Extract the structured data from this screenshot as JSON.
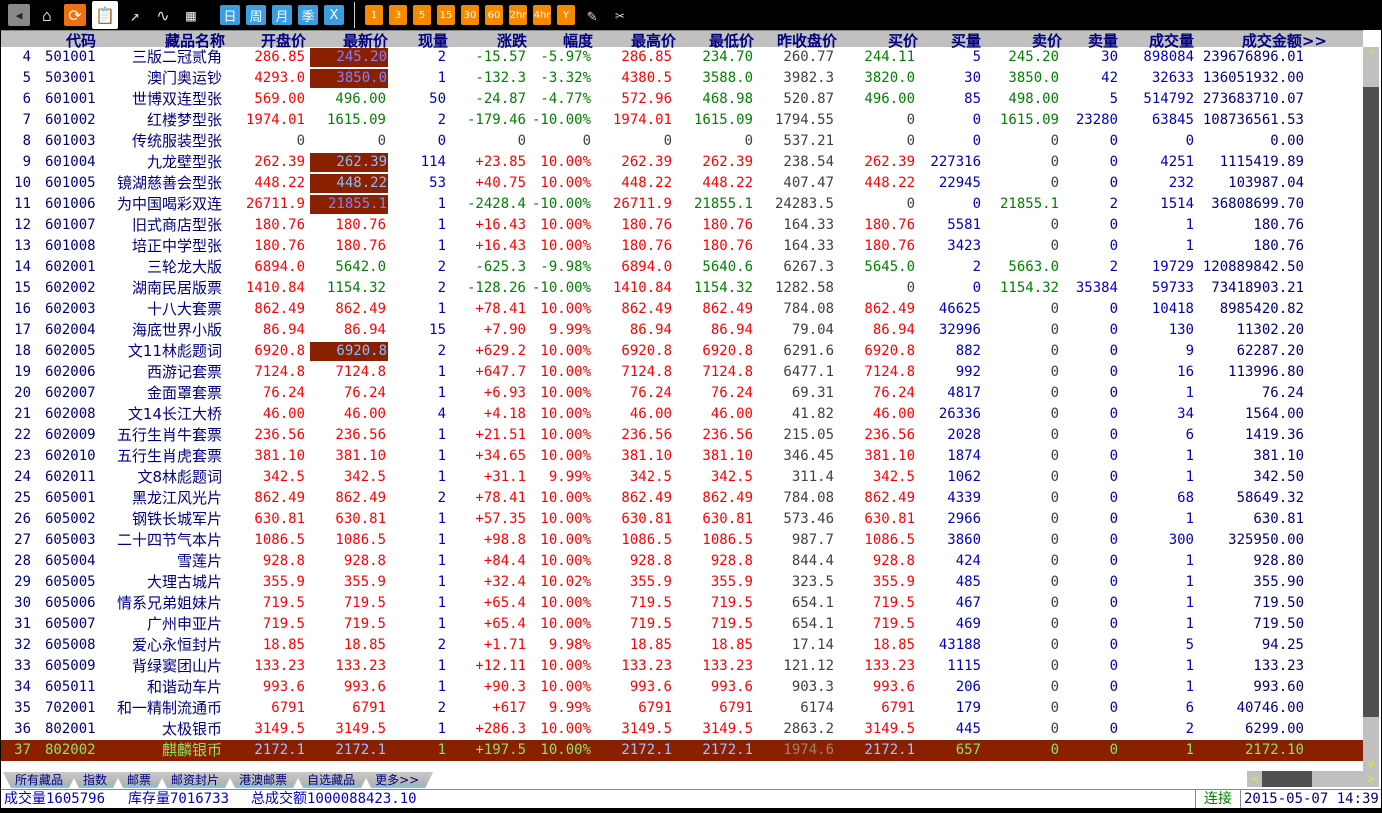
{
  "toolbar": {
    "icons": [
      "back-icon",
      "home-icon",
      "refresh-icon",
      "clipboard-icon",
      "trend-chart-icon",
      "line-chart-icon",
      "table-icon"
    ],
    "period_buttons": [
      "日",
      "周",
      "月",
      "季",
      "X"
    ],
    "minute_buttons": [
      "1",
      "3",
      "5",
      "15",
      "30",
      "60",
      "2hr",
      "4hr",
      "Y"
    ],
    "tools": [
      "pencil-icon",
      "tools-icon"
    ]
  },
  "table": {
    "headers": [
      "代码",
      "藏品名称",
      "开盘价",
      "最新价",
      "现量",
      "涨跌",
      "幅度",
      "最高价",
      "最低价",
      "昨收盘价",
      "买价",
      "买量",
      "卖价",
      "卖量",
      "成交量",
      "成交金额>>"
    ],
    "rows": [
      [
        "4",
        "501001",
        "三版二冠贰角",
        "286.85",
        "245.20",
        "2",
        "-15.57",
        "-5.97%",
        "286.85",
        "234.70",
        "260.77",
        "244.11",
        "5",
        "245.20",
        "30",
        "898084",
        "239676896.01"
      ],
      [
        "5",
        "503001",
        "澳门奥运钞",
        "4293.0",
        "3850.0",
        "1",
        "-132.3",
        "-3.32%",
        "4380.5",
        "3588.0",
        "3982.3",
        "3820.0",
        "30",
        "3850.0",
        "42",
        "32633",
        "136051932.00"
      ],
      [
        "6",
        "601001",
        "世博双连型张",
        "569.00",
        "496.00",
        "50",
        "-24.87",
        "-4.77%",
        "572.96",
        "468.98",
        "520.87",
        "496.00",
        "85",
        "498.00",
        "5",
        "514792",
        "273683710.07"
      ],
      [
        "7",
        "601002",
        "红楼梦型张",
        "1974.01",
        "1615.09",
        "2",
        "-179.46",
        "-10.00%",
        "1974.01",
        "1615.09",
        "1794.55",
        "0",
        "0",
        "1615.09",
        "23280",
        "63845",
        "108736561.53"
      ],
      [
        "8",
        "601003",
        "传统服装型张",
        "0",
        "0",
        "0",
        "0",
        "0",
        "0",
        "0",
        "537.21",
        "0",
        "0",
        "0",
        "0",
        "0",
        "0.00"
      ],
      [
        "9",
        "601004",
        "九龙壁型张",
        "262.39",
        "262.39",
        "114",
        "+23.85",
        "10.00%",
        "262.39",
        "262.39",
        "238.54",
        "262.39",
        "227316",
        "0",
        "0",
        "4251",
        "1115419.89"
      ],
      [
        "10",
        "601005",
        "镜湖慈善会型张",
        "448.22",
        "448.22",
        "53",
        "+40.75",
        "10.00%",
        "448.22",
        "448.22",
        "407.47",
        "448.22",
        "22945",
        "0",
        "0",
        "232",
        "103987.04"
      ],
      [
        "11",
        "601006",
        "为中国喝彩双连",
        "26711.9",
        "21855.1",
        "1",
        "-2428.4",
        "-10.00%",
        "26711.9",
        "21855.1",
        "24283.5",
        "0",
        "0",
        "21855.1",
        "2",
        "1514",
        "36808699.70"
      ],
      [
        "12",
        "601007",
        "旧式商店型张",
        "180.76",
        "180.76",
        "1",
        "+16.43",
        "10.00%",
        "180.76",
        "180.76",
        "164.33",
        "180.76",
        "5581",
        "0",
        "0",
        "1",
        "180.76"
      ],
      [
        "13",
        "601008",
        "培正中学型张",
        "180.76",
        "180.76",
        "1",
        "+16.43",
        "10.00%",
        "180.76",
        "180.76",
        "164.33",
        "180.76",
        "3423",
        "0",
        "0",
        "1",
        "180.76"
      ],
      [
        "14",
        "602001",
        "三轮龙大版",
        "6894.0",
        "5642.0",
        "2",
        "-625.3",
        "-9.98%",
        "6894.0",
        "5640.6",
        "6267.3",
        "5645.0",
        "2",
        "5663.0",
        "2",
        "19729",
        "120889842.50"
      ],
      [
        "15",
        "602002",
        "湖南民居版票",
        "1410.84",
        "1154.32",
        "2",
        "-128.26",
        "-10.00%",
        "1410.84",
        "1154.32",
        "1282.58",
        "0",
        "0",
        "1154.32",
        "35384",
        "59733",
        "73418903.21"
      ],
      [
        "16",
        "602003",
        "十八大套票",
        "862.49",
        "862.49",
        "1",
        "+78.41",
        "10.00%",
        "862.49",
        "862.49",
        "784.08",
        "862.49",
        "46625",
        "0",
        "0",
        "10418",
        "8985420.82"
      ],
      [
        "17",
        "602004",
        "海底世界小版",
        "86.94",
        "86.94",
        "15",
        "+7.90",
        "9.99%",
        "86.94",
        "86.94",
        "79.04",
        "86.94",
        "32996",
        "0",
        "0",
        "130",
        "11302.20"
      ],
      [
        "18",
        "602005",
        "文11林彪题词",
        "6920.8",
        "6920.8",
        "2",
        "+629.2",
        "10.00%",
        "6920.8",
        "6920.8",
        "6291.6",
        "6920.8",
        "882",
        "0",
        "0",
        "9",
        "62287.20"
      ],
      [
        "19",
        "602006",
        "西游记套票",
        "7124.8",
        "7124.8",
        "1",
        "+647.7",
        "10.00%",
        "7124.8",
        "7124.8",
        "6477.1",
        "7124.8",
        "992",
        "0",
        "0",
        "16",
        "113996.80"
      ],
      [
        "20",
        "602007",
        "金面罩套票",
        "76.24",
        "76.24",
        "1",
        "+6.93",
        "10.00%",
        "76.24",
        "76.24",
        "69.31",
        "76.24",
        "4817",
        "0",
        "0",
        "1",
        "76.24"
      ],
      [
        "21",
        "602008",
        "文14长江大桥",
        "46.00",
        "46.00",
        "4",
        "+4.18",
        "10.00%",
        "46.00",
        "46.00",
        "41.82",
        "46.00",
        "26336",
        "0",
        "0",
        "34",
        "1564.00"
      ],
      [
        "22",
        "602009",
        "五行生肖牛套票",
        "236.56",
        "236.56",
        "1",
        "+21.51",
        "10.00%",
        "236.56",
        "236.56",
        "215.05",
        "236.56",
        "2028",
        "0",
        "0",
        "6",
        "1419.36"
      ],
      [
        "23",
        "602010",
        "五行生肖虎套票",
        "381.10",
        "381.10",
        "1",
        "+34.65",
        "10.00%",
        "381.10",
        "381.10",
        "346.45",
        "381.10",
        "1874",
        "0",
        "0",
        "1",
        "381.10"
      ],
      [
        "24",
        "602011",
        "文8林彪题词",
        "342.5",
        "342.5",
        "1",
        "+31.1",
        "9.99%",
        "342.5",
        "342.5",
        "311.4",
        "342.5",
        "1062",
        "0",
        "0",
        "1",
        "342.50"
      ],
      [
        "25",
        "605001",
        "黑龙江风光片",
        "862.49",
        "862.49",
        "2",
        "+78.41",
        "10.00%",
        "862.49",
        "862.49",
        "784.08",
        "862.49",
        "4339",
        "0",
        "0",
        "68",
        "58649.32"
      ],
      [
        "26",
        "605002",
        "钢铁长城军片",
        "630.81",
        "630.81",
        "1",
        "+57.35",
        "10.00%",
        "630.81",
        "630.81",
        "573.46",
        "630.81",
        "2966",
        "0",
        "0",
        "1",
        "630.81"
      ],
      [
        "27",
        "605003",
        "二十四节气本片",
        "1086.5",
        "1086.5",
        "1",
        "+98.8",
        "10.00%",
        "1086.5",
        "1086.5",
        "987.7",
        "1086.5",
        "3860",
        "0",
        "0",
        "300",
        "325950.00"
      ],
      [
        "28",
        "605004",
        "雪莲片",
        "928.8",
        "928.8",
        "1",
        "+84.4",
        "10.00%",
        "928.8",
        "928.8",
        "844.4",
        "928.8",
        "424",
        "0",
        "0",
        "1",
        "928.80"
      ],
      [
        "29",
        "605005",
        "大理古城片",
        "355.9",
        "355.9",
        "1",
        "+32.4",
        "10.02%",
        "355.9",
        "355.9",
        "323.5",
        "355.9",
        "485",
        "0",
        "0",
        "1",
        "355.90"
      ],
      [
        "30",
        "605006",
        "情系兄弟姐妹片",
        "719.5",
        "719.5",
        "1",
        "+65.4",
        "10.00%",
        "719.5",
        "719.5",
        "654.1",
        "719.5",
        "467",
        "0",
        "0",
        "1",
        "719.50"
      ],
      [
        "31",
        "605007",
        "广州申亚片",
        "719.5",
        "719.5",
        "1",
        "+65.4",
        "10.00%",
        "719.5",
        "719.5",
        "654.1",
        "719.5",
        "469",
        "0",
        "0",
        "1",
        "719.50"
      ],
      [
        "32",
        "605008",
        "爱心永恒封片",
        "18.85",
        "18.85",
        "2",
        "+1.71",
        "9.98%",
        "18.85",
        "18.85",
        "17.14",
        "18.85",
        "43188",
        "0",
        "0",
        "5",
        "94.25"
      ],
      [
        "33",
        "605009",
        "背绿窦团山片",
        "133.23",
        "133.23",
        "1",
        "+12.11",
        "10.00%",
        "133.23",
        "133.23",
        "121.12",
        "133.23",
        "1115",
        "0",
        "0",
        "1",
        "133.23"
      ],
      [
        "34",
        "605011",
        "和谐动车片",
        "993.6",
        "993.6",
        "1",
        "+90.3",
        "10.00%",
        "993.6",
        "993.6",
        "903.3",
        "993.6",
        "206",
        "0",
        "0",
        "1",
        "993.60"
      ],
      [
        "35",
        "702001",
        "和一精制流通币",
        "6791",
        "6791",
        "2",
        "+617",
        "9.99%",
        "6791",
        "6791",
        "6174",
        "6791",
        "179",
        "0",
        "0",
        "6",
        "40746.00"
      ],
      [
        "36",
        "802001",
        "太极银币",
        "3149.5",
        "3149.5",
        "1",
        "+286.3",
        "10.00%",
        "3149.5",
        "3149.5",
        "2863.2",
        "3149.5",
        "445",
        "0",
        "0",
        "2",
        "6299.00"
      ],
      [
        "37",
        "802002",
        "麒麟银币",
        "2172.1",
        "2172.1",
        "1",
        "+197.5",
        "10.00%",
        "2172.1",
        "2172.1",
        "1974.6",
        "2172.1",
        "657",
        "0",
        "0",
        "1",
        "2172.10"
      ]
    ],
    "flash_rows": [
      "4",
      "5",
      "9",
      "10",
      "11",
      "18"
    ],
    "selected_row": "37"
  },
  "tabs": [
    "所有藏品",
    "指数",
    "邮票",
    "邮资封片",
    "港澳邮票",
    "自选藏品",
    "更多>>"
  ],
  "status": {
    "volume": "成交量1605796",
    "stock": "库存量7016733",
    "amount": "总成交额1000088423.10",
    "connection": "连接",
    "datetime": "2015-05-07 14:39"
  },
  "colors": {
    "up": "#ff0000",
    "down": "#008000",
    "flat": "#404040",
    "selected_bg": "#8b2000"
  }
}
